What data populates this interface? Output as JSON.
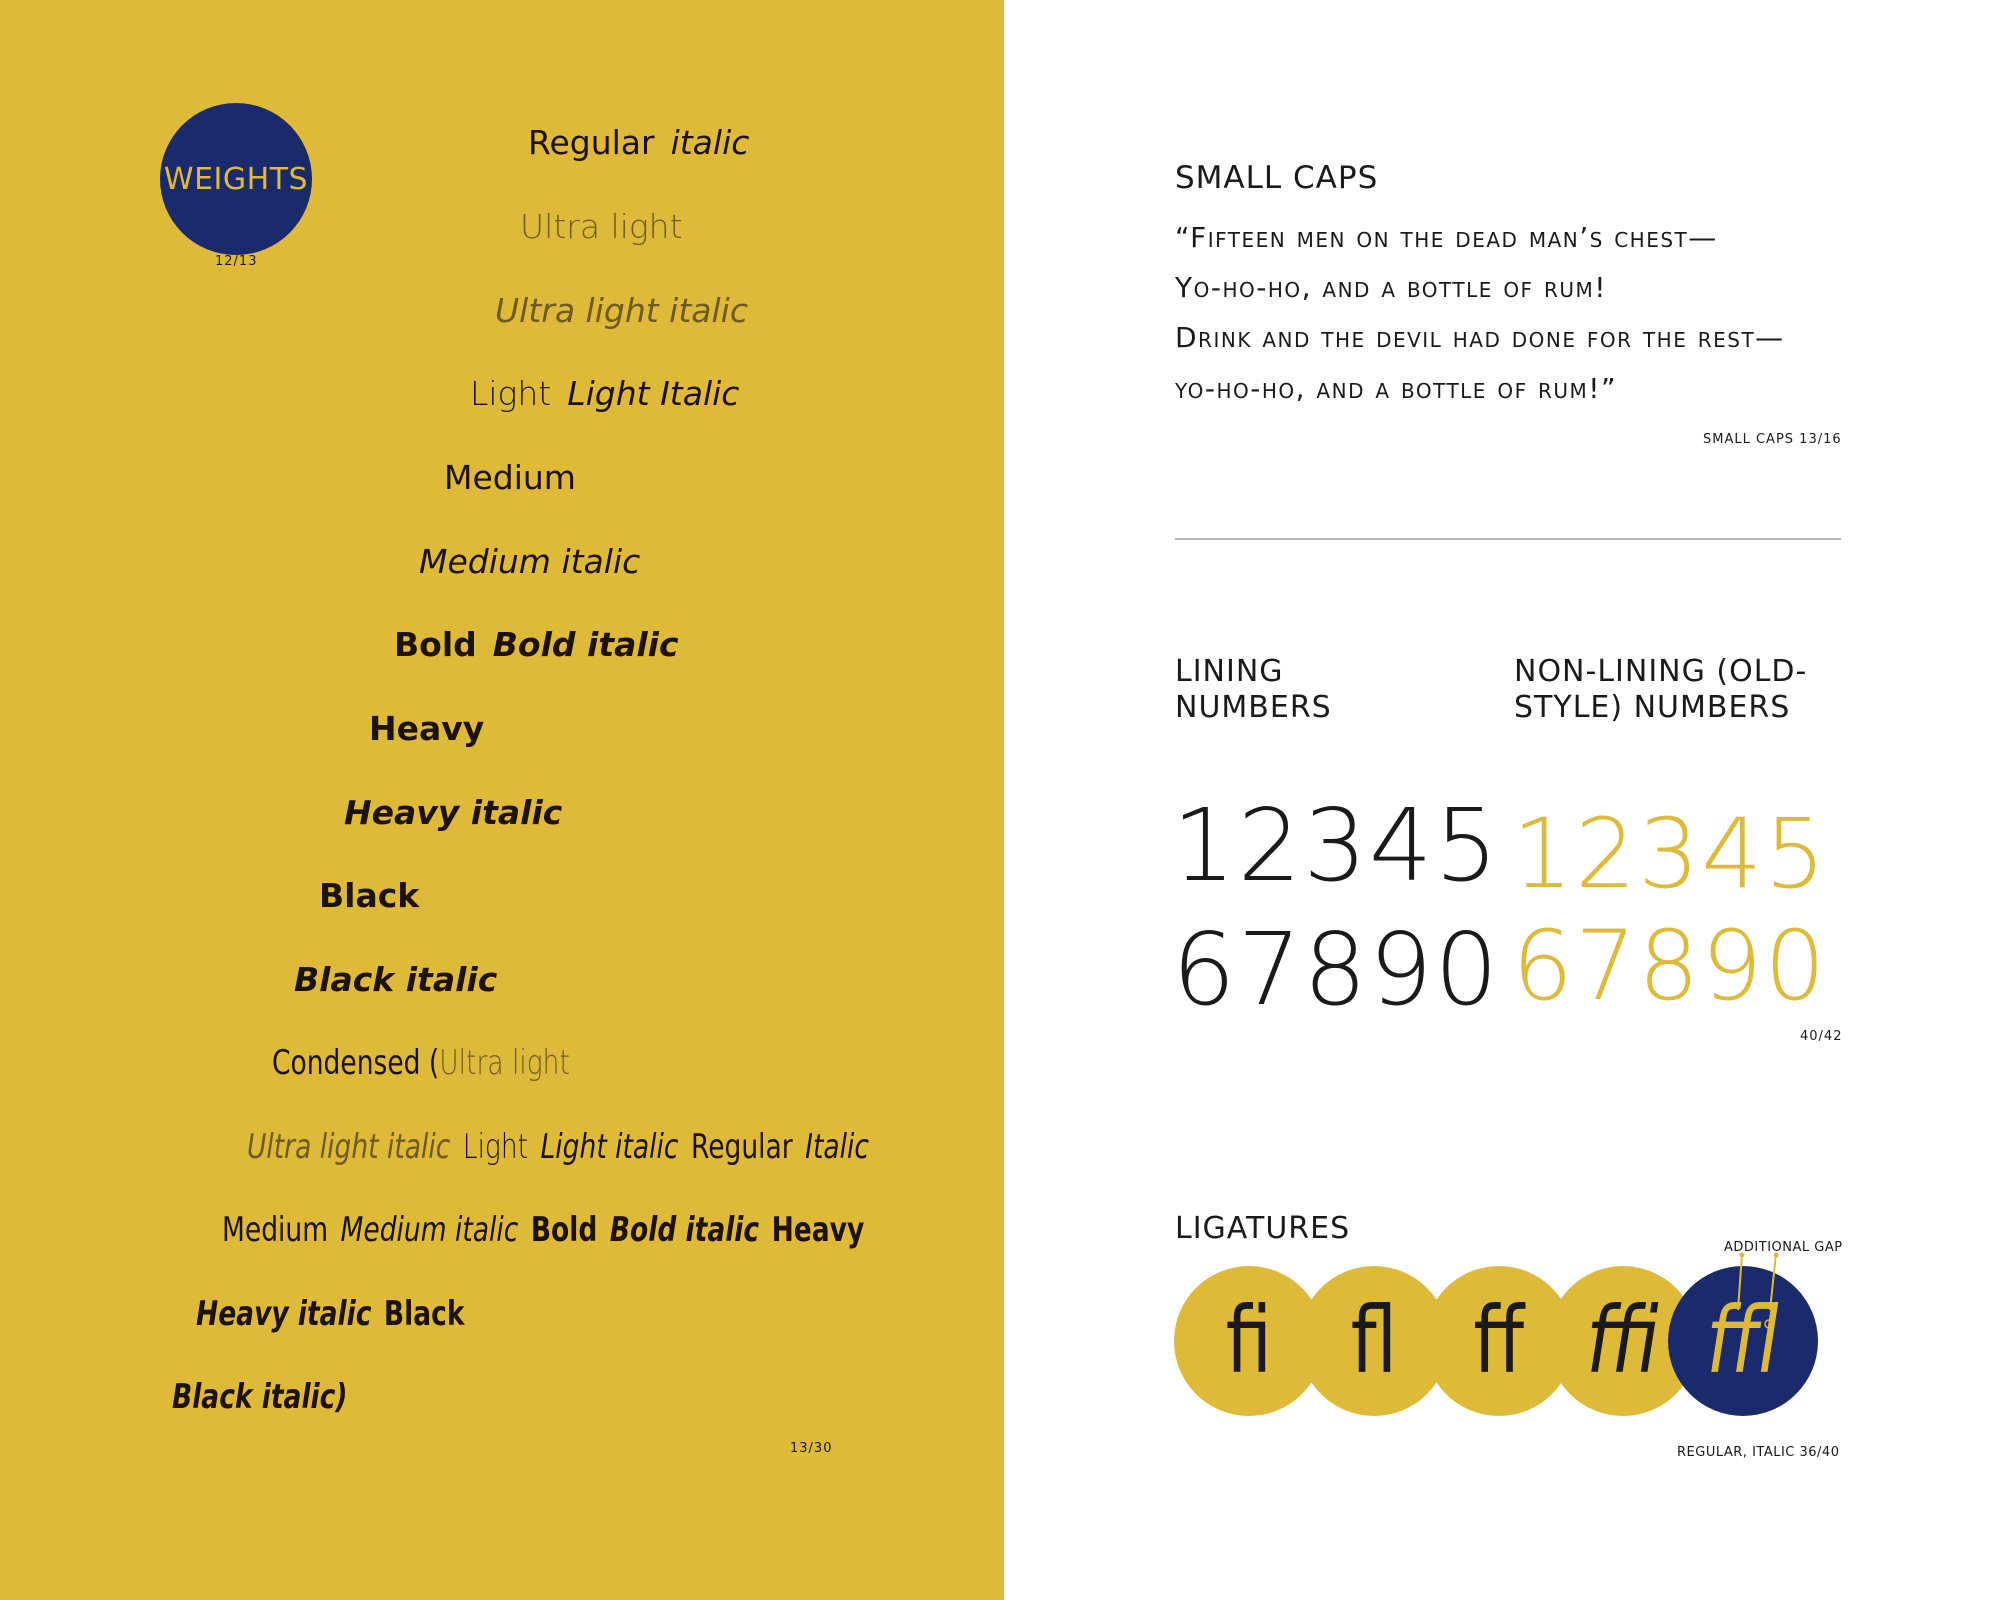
{
  "left_page": {
    "badge": "WEIGHTS",
    "badge_caption": "12/13",
    "line1": {
      "a": "Regular",
      "b": "italic"
    },
    "line2": "Ultra light",
    "line3": "Ultra light italic",
    "line4": {
      "a": "Light",
      "b": "Light Italic"
    },
    "line5": "Medium",
    "line6": "Medium italic",
    "line7": {
      "a": "Bold",
      "b": "Bold italic"
    },
    "line8": "Heavy",
    "line9": "Heavy italic",
    "line10": "Black",
    "line11": "Black italic",
    "line12": {
      "a": "Condensed (",
      "b": "Ultra light"
    },
    "line13": {
      "a": "Ultra light italic",
      "b": "Light",
      "c": "Light italic",
      "d": "Regular",
      "e": "Italic"
    },
    "line14": {
      "a": "Medium",
      "b": "Medium italic",
      "c": "Bold",
      "d": "Bold italic",
      "e": "Heavy"
    },
    "line15": {
      "a": "Heavy italic",
      "b": "Black"
    },
    "line16": "Black italic)",
    "footer": "13/30"
  },
  "right_page": {
    "small_caps": {
      "title": "SMALL CAPS",
      "lines": [
        "“Fifteen men on the dead man’s chest—",
        "Yo-ho-ho, and a bottle of rum!",
        "Drink and the devil had done for the rest—",
        "yo-ho-ho, and a bottle of rum!”"
      ],
      "caption": "SMALL CAPS 13/16"
    },
    "numbers": {
      "lining_heading_1": "LINING",
      "lining_heading_2": "NUMBERS",
      "oldstyle_heading_1": "NON-LINING (OLD-",
      "oldstyle_heading_2": "STYLE) NUMBERS",
      "lining_row1": "12345",
      "lining_row2": "67890",
      "oldstyle_row1": "12345",
      "oldstyle_row2": "67890",
      "caption": "40/42"
    },
    "ligatures": {
      "title": "LIGATURES",
      "items": [
        "fi",
        "fl",
        "ff",
        "ffi",
        "ffl"
      ],
      "gap_label": "ADDITIONAL GAP",
      "caption": "REGULAR, ITALIC 36/40"
    }
  },
  "colors": {
    "mustard": "#dfba39",
    "navy": "#1b2a6b",
    "ink": "#1a1a1a"
  }
}
